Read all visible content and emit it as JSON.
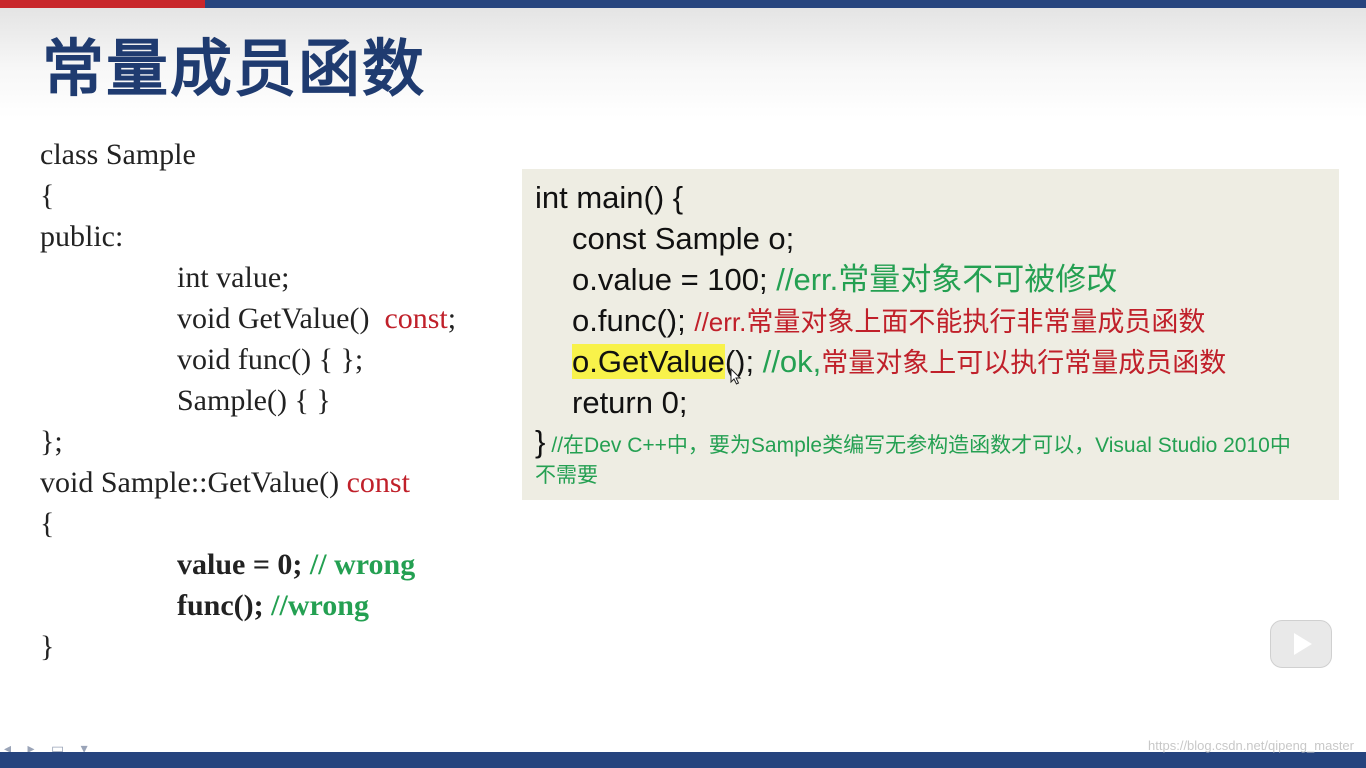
{
  "title": "常量成员函数",
  "left_code": {
    "line1": "class Sample",
    "line2": "{",
    "line3": "public:",
    "line4": "int value;",
    "line5_pre": "void GetValue()",
    "line5_kw": "const",
    "line5_post": ";",
    "line6": "void func() { };",
    "line7": "Sample() { }",
    "line8": "};",
    "line9_pre": "void Sample::GetValue()",
    "line9_kw": "const",
    "line10": "{",
    "line11_code": "value = 0;",
    "line11_comment": "// wrong",
    "line12_code": "func();",
    "line12_comment": "//wrong",
    "line13": "}"
  },
  "right_code": {
    "line1": "int main()  {",
    "line2": "const Sample o;",
    "line3_code": "o.value = 100;",
    "line3_comment": "//err.常量对象不可被修改",
    "line4_code": "o.func();",
    "line4_comment_a": "//err.",
    "line4_comment_b": "常量对象上面不能执行非常量成员函数",
    "line5_code_hl": "o.GetValue",
    "line5_code": "();",
    "line5_comment_a": "//ok,",
    "line5_comment_b": "常量对象上可以执行常量成员函数",
    "line6": "return 0;",
    "line7_brace": "}",
    "note": "//在Dev C++中，要为Sample类编写无参构造函数才可以，Visual Studio 2010中不需要"
  },
  "watermark": "https://blog.csdn.net/qipeng_master",
  "colors": {
    "title": "#1f3b70",
    "keyword_red": "#c0202a",
    "comment_green": "#24a052",
    "highlight": "#f8f24a",
    "codebox_bg": "#eeede3"
  },
  "icons": {
    "play": "play-icon",
    "cursor": "mouse-cursor-icon"
  }
}
